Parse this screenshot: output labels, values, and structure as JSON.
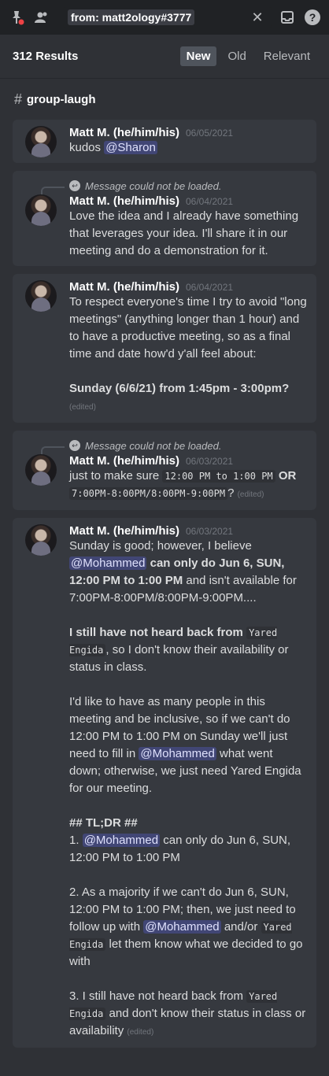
{
  "topbar": {
    "search_value": "from: matt2ology#3777"
  },
  "results_header": {
    "count": "312 Results",
    "sort_options": [
      "New",
      "Old",
      "Relevant"
    ],
    "active_sort": "New"
  },
  "channel": {
    "name": "group-laugh"
  },
  "messages": [
    {
      "author": "Matt M. (he/him/his)",
      "date": "06/05/2021",
      "reply_text": "",
      "text_before_mention": "kudos ",
      "mention": "@Sharon"
    },
    {
      "author": "Matt M. (he/him/his)",
      "date": "06/04/2021",
      "reply_text": "Message could not be loaded.",
      "text": "Love the idea and I already have something that leverages your idea. I'll share it in our meeting and do a demonstration for it."
    },
    {
      "author": "Matt M. (he/him/his)",
      "date": "06/04/2021",
      "text": "To respect everyone's time I try to avoid \"long meetings\" (anything longer than 1 hour) and to have a productive meeting, so as a final time and date how'd y'all feel about:",
      "bold": "Sunday (6/6/21) from 1:45pm - 3:00pm?",
      "edited": "(edited)"
    },
    {
      "author": "Matt M. (he/him/his)",
      "date": "06/03/2021",
      "reply_text": "Message could not be loaded.",
      "text_a": "just to make sure ",
      "code_a": "12:00 PM to 1:00 PM",
      "bold_or": " OR",
      "code_b": "7:00PM-8:00PM/8:00PM-9:00PM",
      "text_b": "?",
      "edited": "(edited)"
    },
    {
      "author": "Matt M. (he/him/his)",
      "date": "06/03/2021",
      "p1_a": "Sunday is good; however, I believe ",
      "p1_mention": "@Mohammed",
      "p1_bold": " can only do Jun 6, SUN, 12:00 PM to 1:00 PM",
      "p1_b": " and isn't available for 7:00PM-8:00PM/8:00PM-9:00PM....",
      "p2_bold": "I still have not heard back from ",
      "p2_code": "Yared Engida",
      "p2_rest": ", so I don't know their availability or status in class.",
      "p3_a": "I'd like to have as many people in this meeting and be inclusive, so if we can't do 12:00 PM to 1:00 PM on Sunday we'll just need to fill in ",
      "p3_mention": "@Mohammed",
      "p3_b": " what went down; otherwise, we just need Yared Engida for our meeting.",
      "tldr": "## TL;DR ##",
      "l1_a": "1. ",
      "l1_mention": "@Mohammed",
      "l1_b": " can only do Jun 6, SUN, 12:00 PM to 1:00 PM",
      "l2_a": "2. As a majority if we can't do Jun 6, SUN, 12:00 PM to 1:00 PM; then, we just need to follow up with ",
      "l2_mention": "@Mohammed",
      "l2_b": " and/or ",
      "l2_code": "Yared Engida",
      "l2_c": " let them know what we decided to go with",
      "l3_a": "3. I still have not heard back from ",
      "l3_code": "Yared Engida",
      "l3_b": " and don't know their status in class or availability",
      "edited": "(edited)"
    }
  ]
}
